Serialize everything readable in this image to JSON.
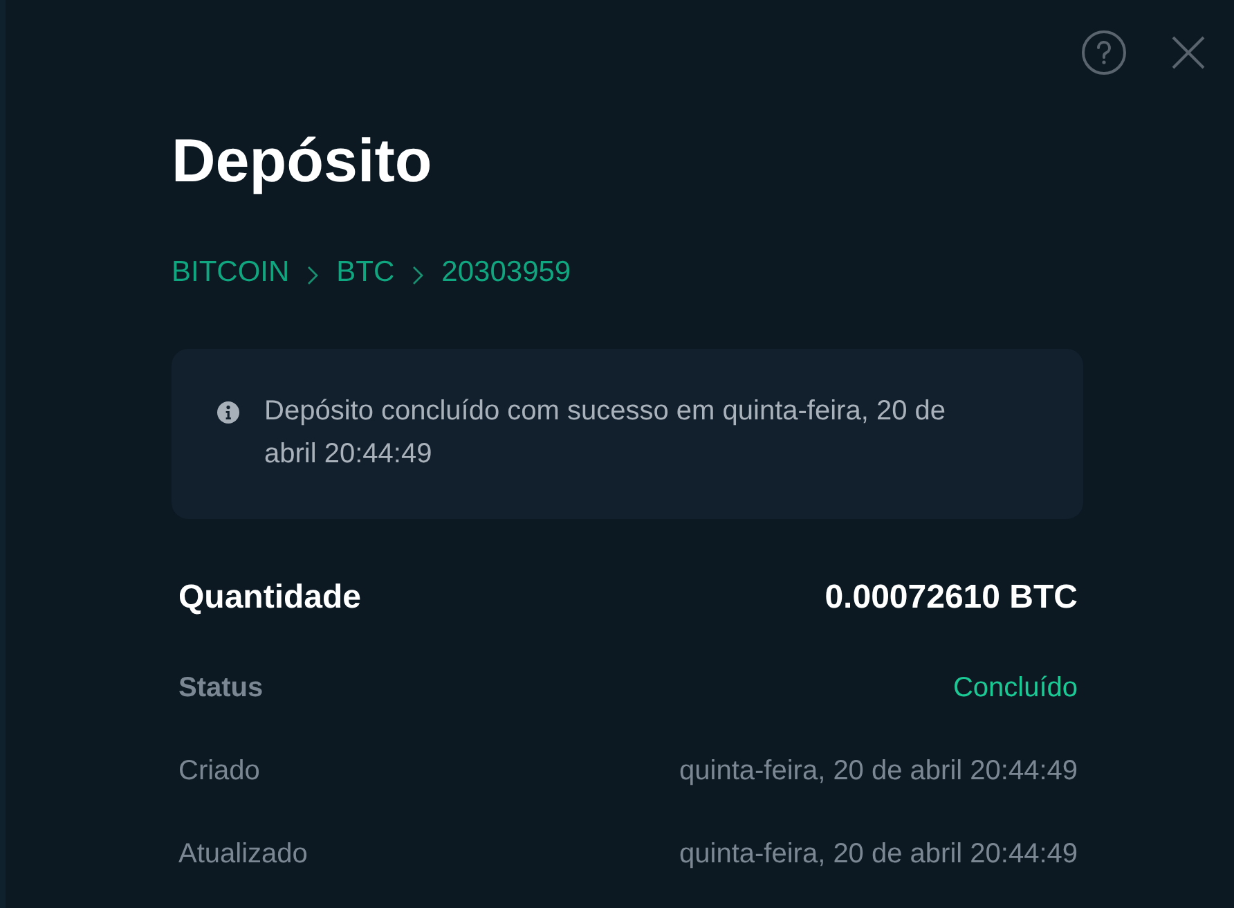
{
  "title": "Depósito",
  "breadcrumb": [
    "BITCOIN",
    "BTC",
    "20303959"
  ],
  "notice": {
    "text": "Depósito concluído com sucesso em quinta-feira, 20 de abril 20:44:49"
  },
  "details": [
    {
      "kind": "amount",
      "label": "Quantidade",
      "value": "0.00072610 BTC"
    },
    {
      "kind": "status",
      "label": "Status",
      "value": "Concluído"
    },
    {
      "kind": "plain",
      "label": "Criado",
      "value": "quinta-feira, 20 de abril 20:44:49"
    },
    {
      "kind": "plain",
      "label": "Atualizado",
      "value": "quinta-feira, 20 de abril 20:44:49"
    }
  ]
}
